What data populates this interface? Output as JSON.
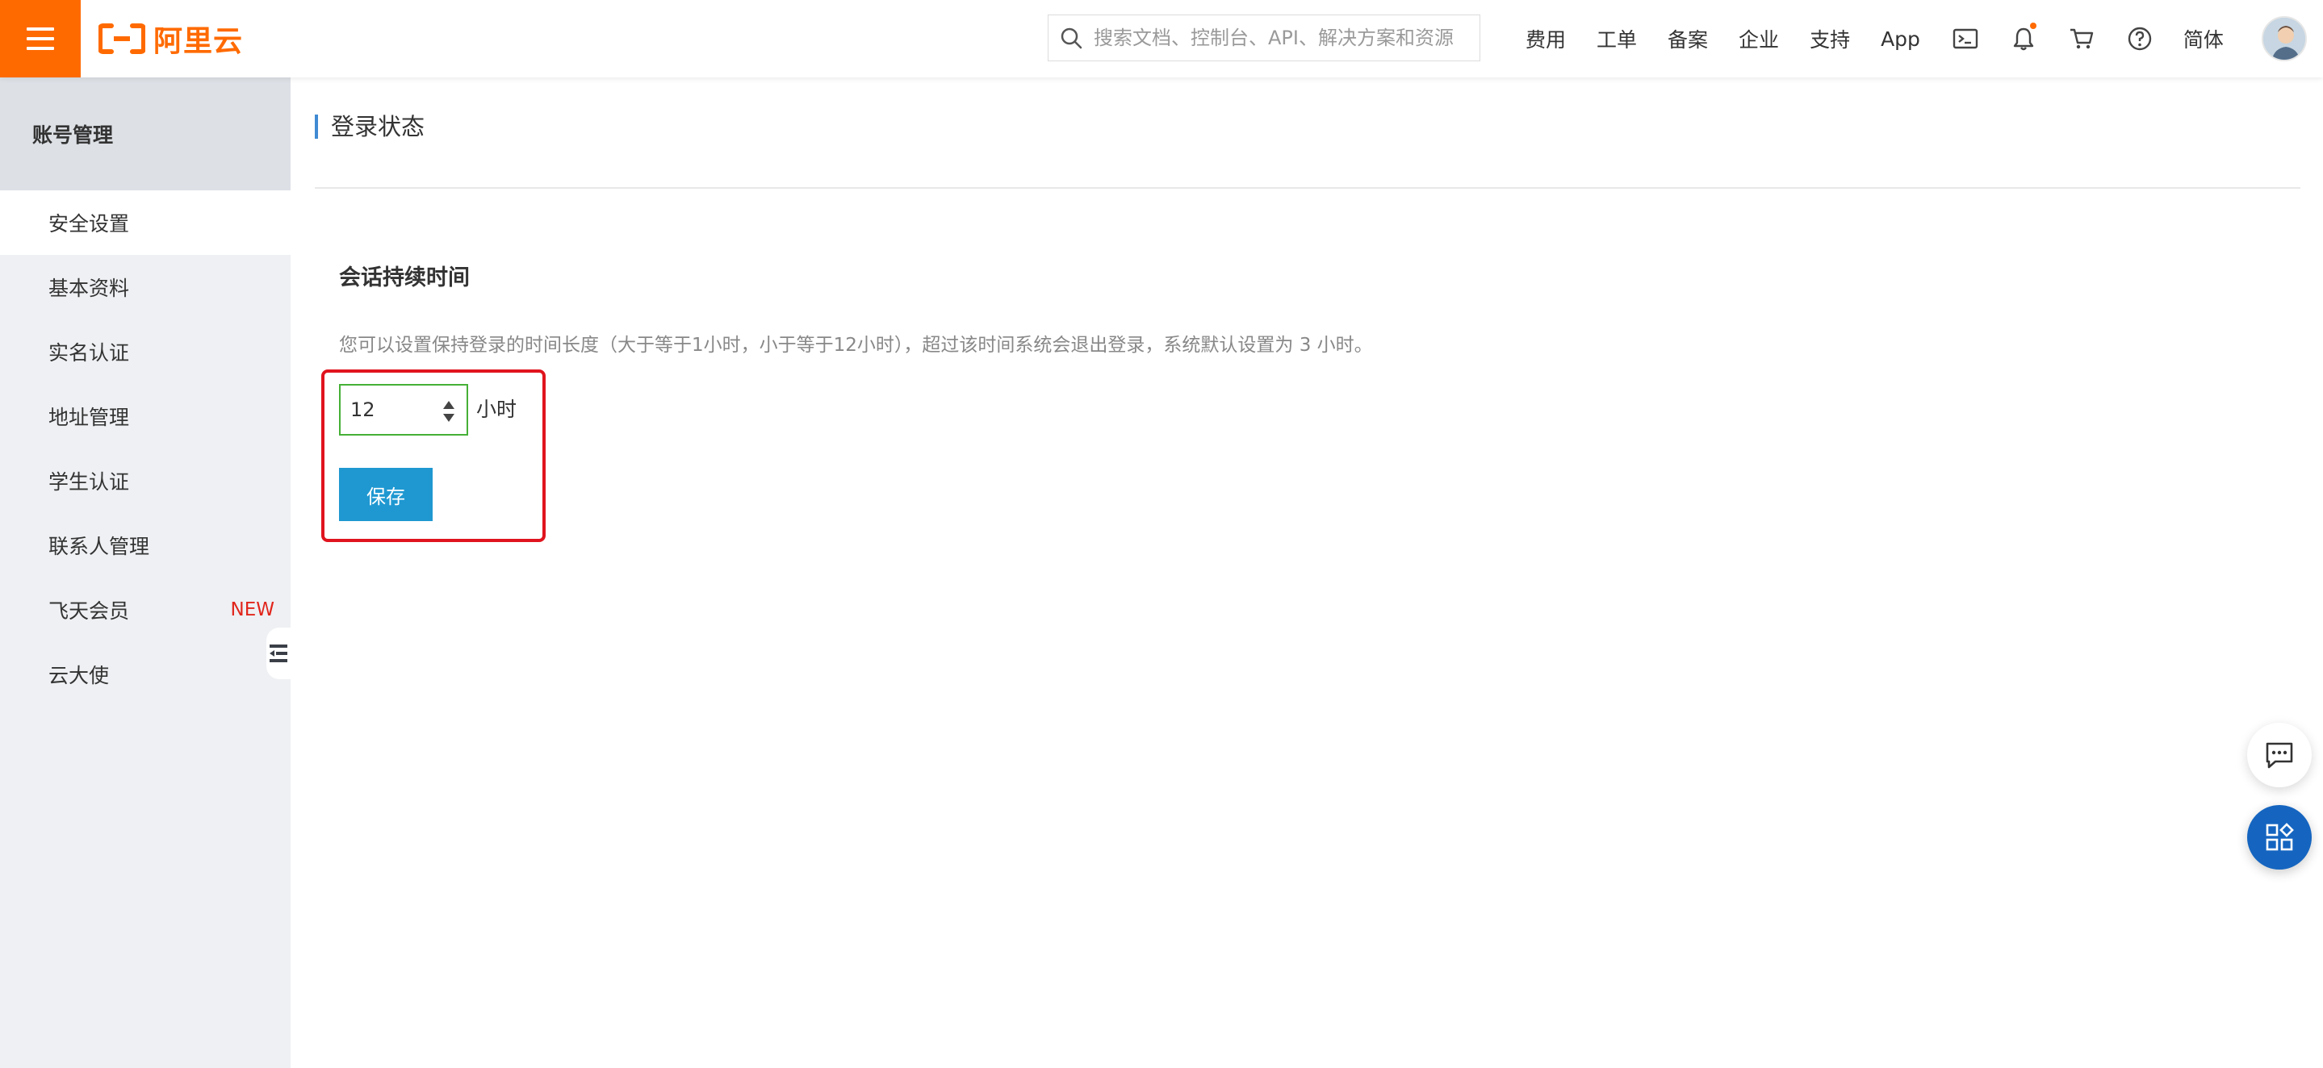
{
  "brand": {
    "name": "阿里云",
    "color": "#ff6a00"
  },
  "search": {
    "placeholder": "搜索文档、控制台、API、解决方案和资源"
  },
  "topnav": {
    "links": [
      "费用",
      "工单",
      "备案",
      "企业",
      "支持",
      "App"
    ],
    "icons": [
      "terminal-icon",
      "bell-icon",
      "cart-icon",
      "help-icon"
    ],
    "language": "简体"
  },
  "sidebar": {
    "header": "账号管理",
    "items": [
      {
        "label": "安全设置",
        "active": true
      },
      {
        "label": "基本资料"
      },
      {
        "label": "实名认证"
      },
      {
        "label": "地址管理"
      },
      {
        "label": "学生认证"
      },
      {
        "label": "联系人管理"
      },
      {
        "label": "飞天会员",
        "badge": "NEW"
      },
      {
        "label": "云大使"
      }
    ]
  },
  "main": {
    "page_title": "登录状态",
    "section_title": "会话持续时间",
    "description": "您可以设置保持登录的时间长度（大于等于1小时，小于等于12小时），超过该时间系统会退出登录，系统默认设置为 3 小时。",
    "session_hours": "12",
    "unit": "小时",
    "save_label": "保存"
  },
  "colors": {
    "accent_blue": "#1f98d1",
    "highlight_red": "#e0141e",
    "input_border_green": "#45b036",
    "badge_red": "#e1251b"
  }
}
